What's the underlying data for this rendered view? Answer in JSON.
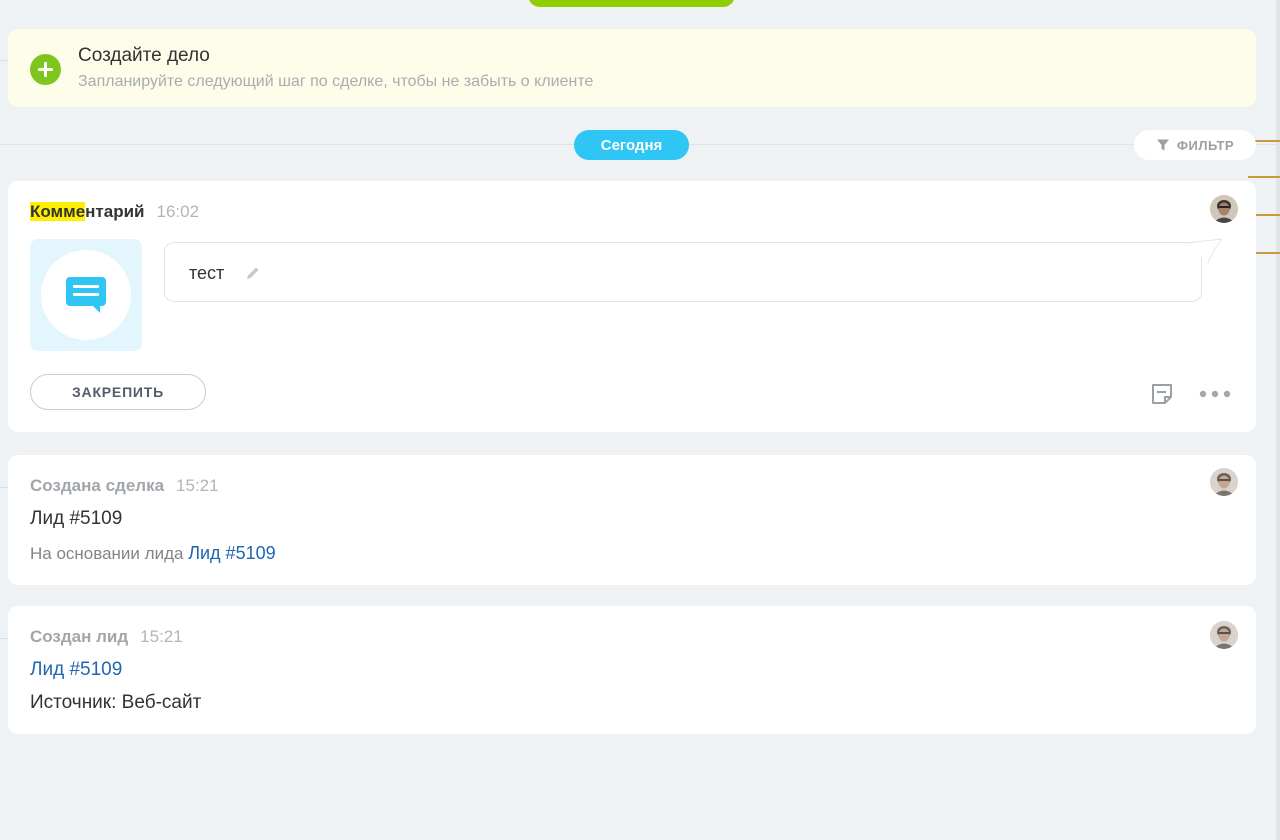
{
  "create_task": {
    "title": "Создайте дело",
    "subtitle": "Запланируйте следующий шаг по сделке, чтобы не забыть о клиенте"
  },
  "timeline": {
    "today_label": "Сегодня",
    "filter_label": "ФИЛЬТР"
  },
  "comment_card": {
    "title_highlight": "Комме",
    "title_rest": "нтарий",
    "time": "16:02",
    "text": "тест",
    "pin_label": "ЗАКРЕПИТЬ"
  },
  "deal_card": {
    "title": "Создана сделка",
    "time": "15:21",
    "name": "Лид #5109",
    "basis_prefix": "На основании лида",
    "basis_link": "Лид #5109"
  },
  "lead_card": {
    "title": "Создан лид",
    "time": "15:21",
    "link": "Лид #5109",
    "source": "Источник: Веб-сайт"
  },
  "colors": {
    "accent_blue": "#2fc6f6",
    "plus_green": "#7ec51e",
    "link_blue": "#2067b0",
    "highlight": "#fff000"
  }
}
